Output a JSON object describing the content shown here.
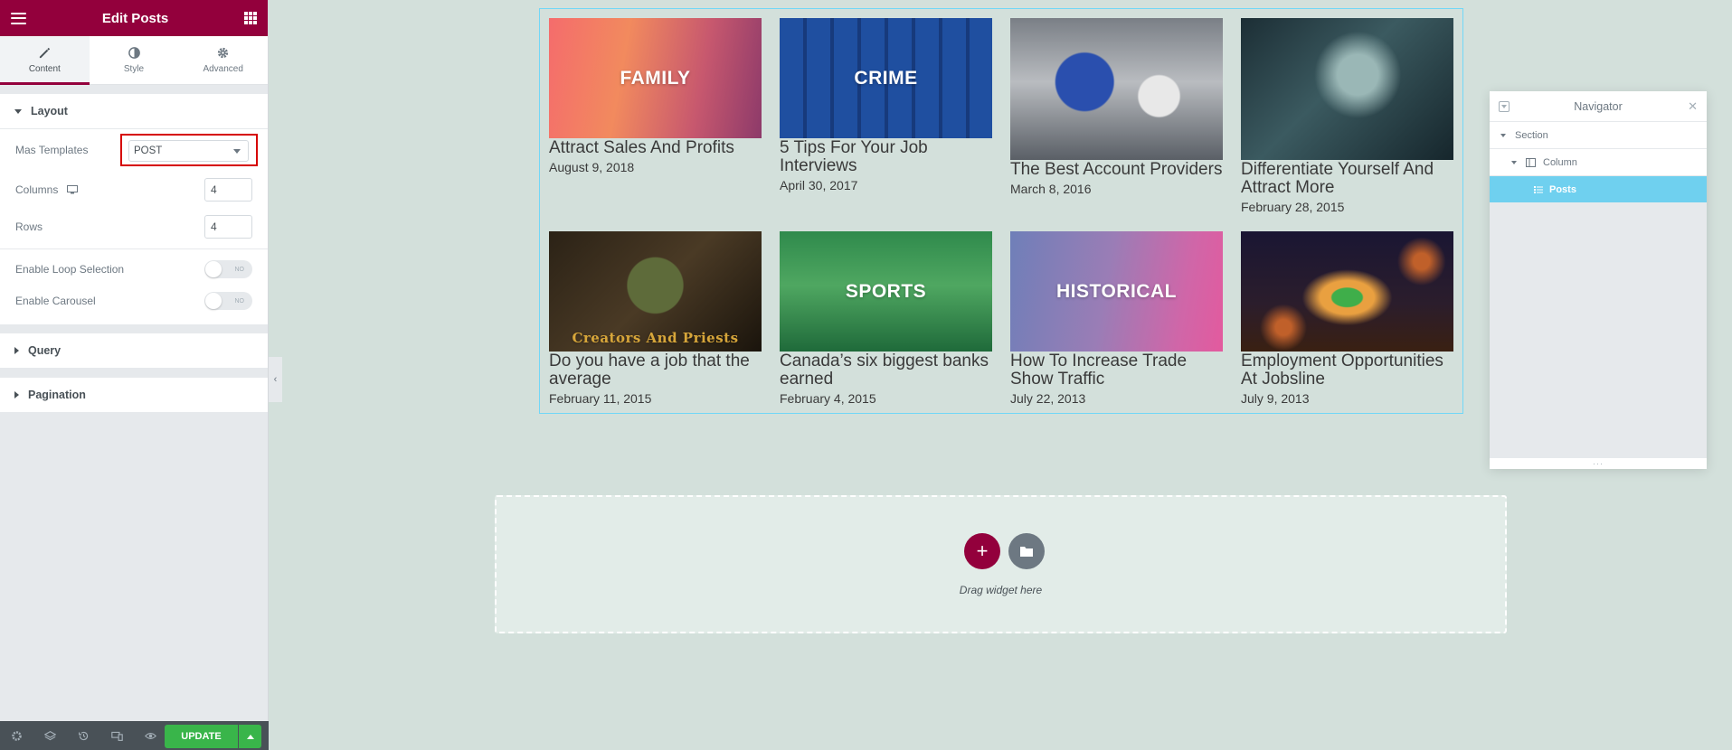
{
  "panel": {
    "title": "Edit Posts",
    "tabs": [
      {
        "label": "Content",
        "icon": "pencil-icon"
      },
      {
        "label": "Style",
        "icon": "half-circle-icon"
      },
      {
        "label": "Advanced",
        "icon": "gear-icon"
      }
    ],
    "layout": {
      "heading": "Layout",
      "mas_templates_label": "Mas Templates",
      "mas_templates_value": "POST",
      "columns_label": "Columns",
      "columns_value": "4",
      "rows_label": "Rows",
      "rows_value": "4",
      "loop_label": "Enable Loop Selection",
      "loop_toggle": "NO",
      "carousel_label": "Enable Carousel",
      "carousel_toggle": "NO"
    },
    "query_heading": "Query",
    "pagination_heading": "Pagination",
    "footer": {
      "update_label": "UPDATE"
    }
  },
  "posts": [
    {
      "title": "Attract Sales And Profits",
      "date": "August 9, 2018",
      "overlay": "FAMILY"
    },
    {
      "title": "5 Tips For Your Job Interviews",
      "date": "April 30, 2017",
      "overlay": "CRIME"
    },
    {
      "title": "The Best Account Providers",
      "date": "March 8, 2016",
      "overlay": ""
    },
    {
      "title": "Differentiate Yourself And Attract More",
      "date": "February 28, 2015",
      "overlay": ""
    },
    {
      "title": "Do you have a job that the average",
      "date": "February 11, 2015",
      "overlay": "Creators And Priests"
    },
    {
      "title": "Canada’s six biggest banks earned",
      "date": "February 4, 2015",
      "overlay": "SPORTS"
    },
    {
      "title": "How To Increase Trade Show Traffic",
      "date": "July 22, 2013",
      "overlay": "HISTORICAL"
    },
    {
      "title": "Employment Opportunities At Jobsline",
      "date": "July 9, 2013",
      "overlay": ""
    }
  ],
  "dropzone": {
    "text": "Drag widget here"
  },
  "navigator": {
    "title": "Navigator",
    "items": [
      "Section",
      "Column",
      "Posts"
    ]
  },
  "colors": {
    "brand": "#93003c",
    "update": "#39b54a",
    "selected": "#6fd0ef"
  }
}
